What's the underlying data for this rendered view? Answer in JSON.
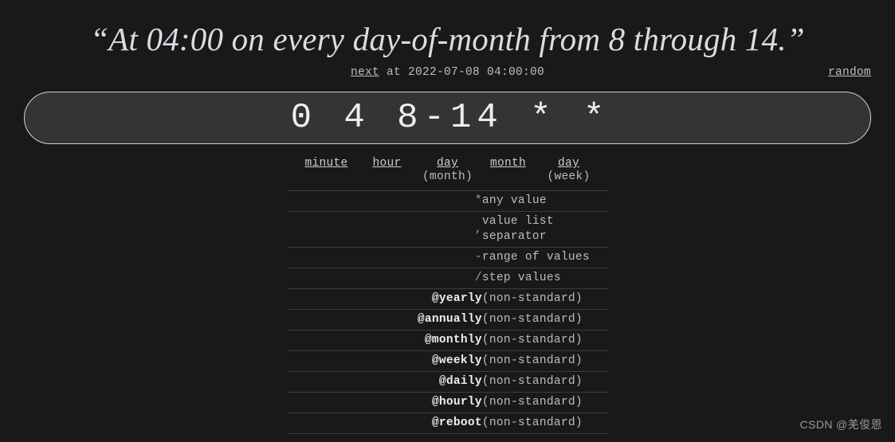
{
  "page": {
    "background_color": "#191919",
    "accent_symbol_color": "#b99b6c",
    "text_color": "#b9bec4"
  },
  "header": {
    "title": "“At 04:00 on every day-of-month from 8 through 14.”",
    "next_link_label": "next",
    "next_text": " at 2022-07-08 04:00:00",
    "random_link_label": "random"
  },
  "cron": {
    "expression": "0 4 8-14 * *",
    "fields": [
      {
        "name": "minute",
        "sub": ""
      },
      {
        "name": "hour",
        "sub": ""
      },
      {
        "name": "day",
        "sub": "(month)"
      },
      {
        "name": "month",
        "sub": ""
      },
      {
        "name": "day",
        "sub": "(week)"
      }
    ]
  },
  "reference_table": {
    "rows": [
      {
        "symbol": "*",
        "description": "any value",
        "keyword": false
      },
      {
        "symbol": ",",
        "description": "value list separator",
        "keyword": false
      },
      {
        "symbol": "-",
        "description": "range of values",
        "keyword": false
      },
      {
        "symbol": "/",
        "description": "step values",
        "keyword": false
      },
      {
        "symbol": "@yearly",
        "description": "(non-standard)",
        "keyword": true
      },
      {
        "symbol": "@annually",
        "description": "(non-standard)",
        "keyword": true
      },
      {
        "symbol": "@monthly",
        "description": "(non-standard)",
        "keyword": true
      },
      {
        "symbol": "@weekly",
        "description": "(non-standard)",
        "keyword": true
      },
      {
        "symbol": "@daily",
        "description": "(non-standard)",
        "keyword": true
      },
      {
        "symbol": "@hourly",
        "description": "(non-standard)",
        "keyword": true
      },
      {
        "symbol": "@reboot",
        "description": "(non-standard)",
        "keyword": true
      }
    ]
  },
  "watermark": {
    "text": "CSDN @羌俊恩"
  }
}
